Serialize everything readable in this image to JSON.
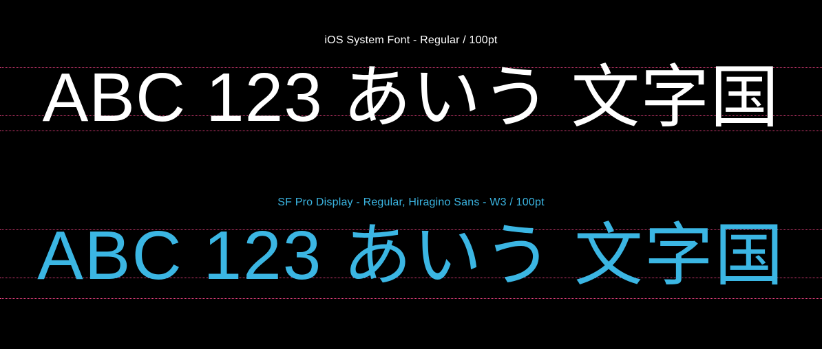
{
  "specimens": [
    {
      "label": "iOS System Font - Regular / 100pt",
      "sample_text": "ABC 123 あいう 文字国",
      "label_color": "#ffffff",
      "text_color": "#ffffff"
    },
    {
      "label": "SF Pro Display - Regular, Hiragino Sans - W3 / 100pt",
      "sample_text": "ABC 123 あいう 文字国",
      "label_color": "#3bb6e3",
      "text_color": "#3bb6e3"
    }
  ],
  "guide_color": "#e6407e",
  "background": "#000000"
}
